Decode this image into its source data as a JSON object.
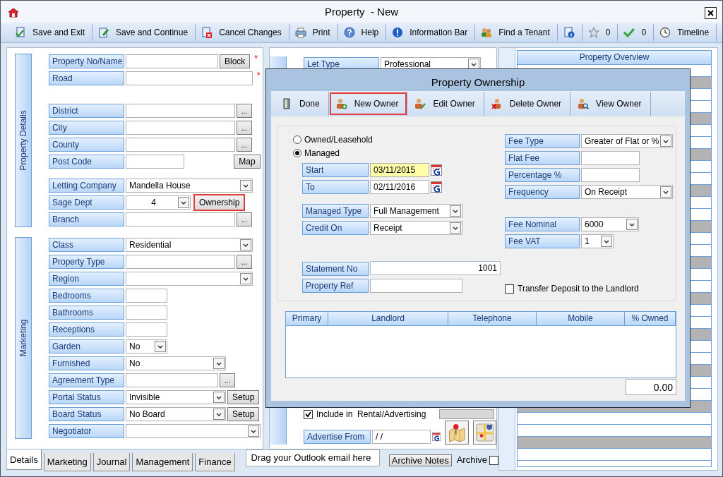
{
  "window": {
    "title": "Property  - New"
  },
  "toolbar": [
    {
      "kind": "button",
      "label": "Save and Exit"
    },
    {
      "kind": "button",
      "label": "Save and Continue"
    },
    {
      "kind": "button",
      "label": "Cancel Changes"
    },
    {
      "kind": "button",
      "label": "Print"
    },
    {
      "kind": "button",
      "label": "Help"
    },
    {
      "kind": "button",
      "label": "Information Bar"
    },
    {
      "kind": "button",
      "label": "Find a Tenant"
    },
    {
      "kind": "icon"
    },
    {
      "kind": "button",
      "label": "0"
    },
    {
      "kind": "button",
      "label": "0"
    },
    {
      "kind": "button",
      "label": "Timeline"
    }
  ],
  "details_sections": [
    {
      "title": "Property Details",
      "groups": [
        [
          {
            "label": "Property No/Name",
            "kind": "text",
            "button": {
              "label": "Block",
              "highlighted": false
            },
            "required_mark": "*"
          },
          {
            "label": "Road",
            "kind": "text",
            "required_mark": "*"
          }
        ],
        [
          {
            "label": "District",
            "kind": "lookup",
            "button": {
              "label": "...",
              "highlighted": false
            }
          },
          {
            "label": "City",
            "kind": "lookup",
            "button": {
              "label": "...",
              "highlighted": false
            }
          },
          {
            "label": "County",
            "kind": "lookup",
            "button": {
              "label": "...",
              "highlighted": false
            }
          },
          {
            "label": "Post Code",
            "kind": "text",
            "button": {
              "label": "Map",
              "highlighted": false
            }
          }
        ],
        [
          {
            "label": "Letting Company",
            "kind": "select",
            "value": "Mandella House"
          },
          {
            "label": "Sage Dept",
            "kind": "select",
            "value": "4",
            "button": {
              "label": "Ownership",
              "highlighted": true
            }
          },
          {
            "label": "Branch",
            "kind": "lookup",
            "button": {
              "label": "...",
              "highlighted": false
            }
          }
        ]
      ]
    },
    {
      "title": "Marketing",
      "groups": [
        [
          {
            "label": "Class",
            "kind": "select",
            "value": "Residential"
          },
          {
            "label": "Property Type",
            "kind": "lookup",
            "button": {
              "label": "...",
              "highlighted": false
            }
          },
          {
            "label": "Region",
            "kind": "select"
          },
          {
            "label": "Bedrooms",
            "kind": "text"
          },
          {
            "label": "Bathrooms",
            "kind": "text"
          },
          {
            "label": "Receptions",
            "kind": "text"
          },
          {
            "label": "Garden",
            "kind": "select",
            "value": "No"
          },
          {
            "label": "Furnished",
            "kind": "select",
            "value": "No"
          },
          {
            "label": "Agreement Type",
            "kind": "lookup",
            "button": {
              "label": "...",
              "highlighted": false
            }
          },
          {
            "label": "Portal Status",
            "kind": "select",
            "value": "Invisible",
            "button": {
              "label": "Setup",
              "highlighted": false
            }
          },
          {
            "label": "Board Status",
            "kind": "select",
            "value": "No Board",
            "button": {
              "label": "Setup",
              "highlighted": false
            }
          },
          {
            "label": "Negotiator",
            "kind": "select"
          }
        ]
      ]
    }
  ],
  "middle": {
    "let_type": {
      "label": "Let Type",
      "kind": "select",
      "value": "Professional"
    },
    "include_advertising": {
      "label": "Include in  Rental/Advertising",
      "checked": true
    },
    "advertise_from": {
      "label": "Advertise From",
      "kind": "date",
      "value": " / /"
    }
  },
  "overview": {
    "title": "Property Overview"
  },
  "bottom_tabs": [
    {
      "label": "Details",
      "selected": true
    },
    {
      "label": "Marketing",
      "selected": false
    },
    {
      "label": "Journal",
      "selected": false
    },
    {
      "label": "Management",
      "selected": false
    },
    {
      "label": "Finance",
      "selected": false
    }
  ],
  "drop_zone": {
    "text": "Drag your Outlook email here"
  },
  "archive_notes_button": "Archive Notes",
  "archive": {
    "label": "Archive",
    "checked": false
  },
  "ownership_dialog": {
    "title": "Property Ownership",
    "toolbar": [
      {
        "label": "Done",
        "highlighted": false
      },
      {
        "label": "New Owner",
        "highlighted": true
      },
      {
        "label": "Edit Owner",
        "highlighted": false
      },
      {
        "label": "Delete Owner",
        "highlighted": false
      },
      {
        "label": "View Owner",
        "highlighted": false
      }
    ],
    "ownership_types": [
      {
        "label": "Owned/Leasehold",
        "selected": false
      },
      {
        "label": "Managed",
        "selected": true
      }
    ],
    "left_groups": [
      [
        {
          "label": "Start",
          "kind": "date",
          "value": "03/11/2015",
          "focused": true
        },
        {
          "label": "To",
          "kind": "date",
          "value": "02/11/2016",
          "focused": false
        }
      ],
      [
        {
          "label": "Managed Type",
          "kind": "select",
          "value": "Full Management"
        },
        {
          "label": "Credit On",
          "kind": "select",
          "value": "Receipt"
        }
      ],
      [
        {
          "label": "Statement No",
          "kind": "text",
          "value": "1001"
        },
        {
          "label": "Property Ref",
          "kind": "text"
        }
      ]
    ],
    "right_groups": [
      [
        {
          "label": "Fee Type",
          "kind": "select",
          "value": "Greater of Flat or %"
        },
        {
          "label": "Flat Fee",
          "kind": "text"
        },
        {
          "label": "Percentage %",
          "kind": "text"
        },
        {
          "label": "Frequency",
          "kind": "select",
          "value": "On Receipt"
        }
      ],
      [
        {
          "label": "Fee Nominal",
          "kind": "select",
          "value": "6000"
        },
        {
          "label": "Fee VAT",
          "kind": "select",
          "value": "1"
        }
      ]
    ],
    "transfer_deposit": {
      "label": "Transfer Deposit to the Landlord",
      "checked": false
    },
    "table": {
      "columns": [
        "Primary",
        "Landlord",
        "Telephone",
        "Mobile",
        "% Owned"
      ]
    },
    "total": "0.00"
  }
}
